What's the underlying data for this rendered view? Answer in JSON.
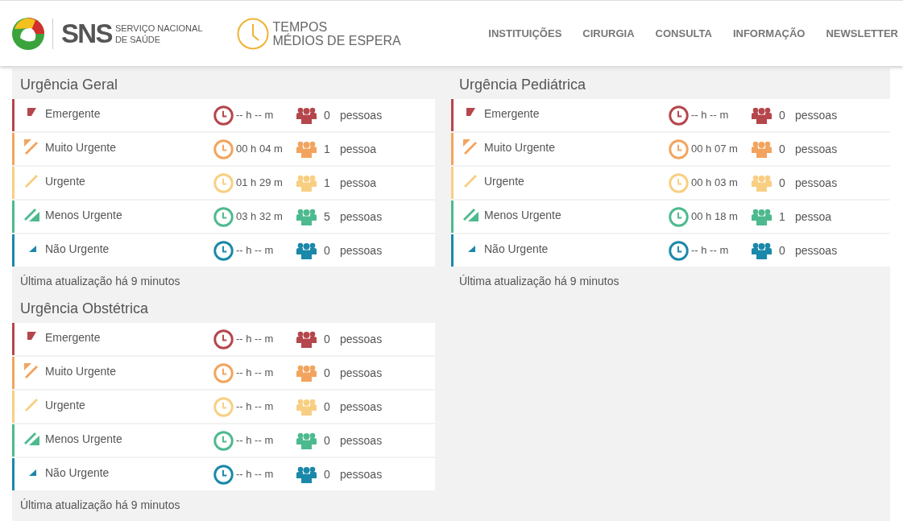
{
  "header": {
    "logo_mark": "SNS",
    "logo_lines": [
      "SERVIÇO NACIONAL",
      "DE SAÚDE"
    ],
    "app_title_lines": [
      "TEMPOS",
      "MÉDIOS DE ESPERA"
    ],
    "nav": [
      "INSTITUIÇÕES",
      "CIRURGIA",
      "CONSULTA",
      "INFORMAÇÃO",
      "NEWSLETTER"
    ]
  },
  "columns": [
    {
      "sections": [
        {
          "title": "Urgência Geral",
          "updated": "Última atualização há 9 minutos",
          "rows": [
            {
              "kind": "emergente",
              "name": "Emergente",
              "color": "#b5464c",
              "time": "-- h -- m",
              "count": "0",
              "unit": "pessoas"
            },
            {
              "kind": "muito-urgente",
              "name": "Muito Urgente",
              "color": "#f2a45e",
              "time": "00 h 04 m",
              "count": "1",
              "unit": "pessoa"
            },
            {
              "kind": "urgente",
              "name": "Urgente",
              "color": "#f8cf82",
              "time": "01 h 29 m",
              "count": "1",
              "unit": "pessoa"
            },
            {
              "kind": "menos-urgente",
              "name": "Menos Urgente",
              "color": "#4dba8e",
              "time": "03 h 32 m",
              "count": "5",
              "unit": "pessoas"
            },
            {
              "kind": "nao-urgente",
              "name": "Não Urgente",
              "color": "#1a88a9",
              "time": "-- h -- m",
              "count": "0",
              "unit": "pessoas"
            }
          ]
        },
        {
          "title": "Urgência Obstétrica",
          "updated": "Última atualização há 9 minutos",
          "rows": [
            {
              "kind": "emergente",
              "name": "Emergente",
              "color": "#b5464c",
              "time": "-- h -- m",
              "count": "0",
              "unit": "pessoas"
            },
            {
              "kind": "muito-urgente",
              "name": "Muito Urgente",
              "color": "#f2a45e",
              "time": "-- h -- m",
              "count": "0",
              "unit": "pessoas"
            },
            {
              "kind": "urgente",
              "name": "Urgente",
              "color": "#f8cf82",
              "time": "-- h -- m",
              "count": "0",
              "unit": "pessoas"
            },
            {
              "kind": "menos-urgente",
              "name": "Menos Urgente",
              "color": "#4dba8e",
              "time": "-- h -- m",
              "count": "0",
              "unit": "pessoas"
            },
            {
              "kind": "nao-urgente",
              "name": "Não Urgente",
              "color": "#1a88a9",
              "time": "-- h -- m",
              "count": "0",
              "unit": "pessoas"
            }
          ]
        }
      ]
    },
    {
      "sections": [
        {
          "title": "Urgência Pediátrica",
          "updated": "Última atualização há 9 minutos",
          "rows": [
            {
              "kind": "emergente",
              "name": "Emergente",
              "color": "#b5464c",
              "time": "-- h -- m",
              "count": "0",
              "unit": "pessoas"
            },
            {
              "kind": "muito-urgente",
              "name": "Muito Urgente",
              "color": "#f2a45e",
              "time": "00 h 07 m",
              "count": "0",
              "unit": "pessoas"
            },
            {
              "kind": "urgente",
              "name": "Urgente",
              "color": "#f8cf82",
              "time": "00 h 03 m",
              "count": "0",
              "unit": "pessoas"
            },
            {
              "kind": "menos-urgente",
              "name": "Menos Urgente",
              "color": "#4dba8e",
              "time": "00 h 18 m",
              "count": "1",
              "unit": "pessoa"
            },
            {
              "kind": "nao-urgente",
              "name": "Não Urgente",
              "color": "#1a88a9",
              "time": "-- h -- m",
              "count": "0",
              "unit": "pessoas"
            }
          ]
        }
      ]
    }
  ]
}
